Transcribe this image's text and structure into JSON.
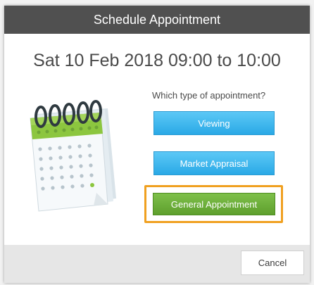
{
  "dialog": {
    "title": "Schedule Appointment",
    "subtitle": "Sat 10 Feb 2018 09:00 to 10:00",
    "question": "Which type of appointment?",
    "options": [
      {
        "label": "Viewing"
      },
      {
        "label": "Market Appraisal"
      },
      {
        "label": "General Appointment"
      }
    ],
    "cancel_label": "Cancel",
    "illustration": "calendar-icon"
  },
  "colors": {
    "titlebar": "#505050",
    "blue_button": "#2aa9e6",
    "green_button": "#5e9f2d",
    "highlight": "#f0a020",
    "footer": "#e6e6e6"
  }
}
